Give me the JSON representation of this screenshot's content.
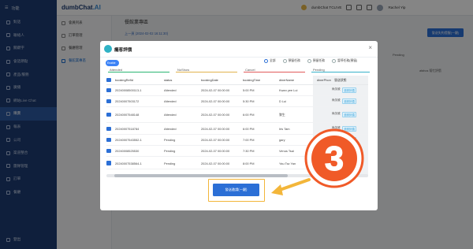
{
  "sidebar": {
    "top_label": "功能",
    "items": [
      {
        "label": "對話"
      },
      {
        "label": "聯絡人"
      },
      {
        "label": "關鍵字"
      },
      {
        "label": "會話節點"
      },
      {
        "label": "產品/服務"
      },
      {
        "label": "廣播"
      },
      {
        "label": "網站Live Chat"
      },
      {
        "label": "購賣"
      },
      {
        "label": "報表"
      },
      {
        "label": "公司"
      },
      {
        "label": "渠道整合"
      },
      {
        "label": "團隊管理"
      },
      {
        "label": "訂單"
      },
      {
        "label": "餐廳"
      }
    ],
    "active_index": 7,
    "bottom_label": "登出"
  },
  "topbar": {
    "brand_main": "dumbChat",
    "brand_suffix": ".AI",
    "account": "dumbChat TCLIVE",
    "user": "Rachel Yip"
  },
  "subnav": {
    "items": [
      {
        "label": "會員列表"
      },
      {
        "label": "訂單管理"
      },
      {
        "label": "餐廳管理"
      },
      {
        "label": "餐館業專區"
      }
    ],
    "active_index": 3
  },
  "main": {
    "title": "餐館業專區",
    "date_line": "上一頁  (2024-02-02 16:11:30)",
    "action_button": "發送失約提醒(一鍵)",
    "bg_status": "Pending",
    "bg_cells": "afahos    幫忙評價"
  },
  "modal": {
    "title": "癱客評價",
    "close": "×",
    "toggle_label": "Enable",
    "radios": [
      {
        "label": "全部",
        "checked": true
      },
      {
        "label": "預留任務",
        "checked": false
      },
      {
        "label": "預留任務",
        "checked": false
      },
      {
        "label": "暫停任務(預留)",
        "checked": false
      }
    ],
    "status_row": [
      {
        "label": "Attended",
        "color": "#2bb673"
      },
      {
        "label": "NoShow",
        "color": "#e2b34d"
      },
      {
        "label": "Cancel",
        "color": "#e25a5a"
      },
      {
        "label": "Pending",
        "color": "#38b2c9"
      }
    ],
    "columns": [
      "bookingRefId",
      "status",
      "bookingDate",
      "bookingTime",
      "dinerName",
      "dinerPhon",
      "發送狀態"
    ],
    "rows": [
      {
        "ref": "20240008500113-1",
        "status": "Attended",
        "date": "2024-02-07 00:00:00",
        "time": "5:00 PM",
        "name": "Kwan yee Lui",
        "a": "尚欠收",
        "b": "邀請評價"
      },
      {
        "ref": "20240007503172",
        "status": "Attended",
        "date": "2024-02-07 00:00:00",
        "time": "5:30 PM",
        "name": "D Lui",
        "a": "尚欠收",
        "b": "邀請評價"
      },
      {
        "ref": "20240007548148",
        "status": "Attended",
        "date": "2024-02-07 00:00:00",
        "time": "6:00 PM",
        "name": "黎生",
        "a": "尚欠收",
        "b": "邀請評價"
      },
      {
        "ref": "20240007518784",
        "status": "Attended",
        "date": "2024-02-07 00:00:00",
        "time": "6:00 PM",
        "name": "Iris Tam",
        "a": "尚欠收",
        "b": "邀請評價"
      },
      {
        "ref": "20240007543552-1",
        "status": "Pending",
        "date": "2024-02-07 00:00:00",
        "time": "7:00 PM",
        "name": "gary",
        "a": "尚欠收",
        "b": "邀請評價"
      },
      {
        "ref": "20240008525530",
        "status": "Pending",
        "date": "2024-02-07 00:00:00",
        "time": "7:30 PM",
        "name": "Venus Tsai",
        "a": "尚欠收",
        "b": "邀請評價"
      },
      {
        "ref": "20240007538564-1",
        "status": "Pending",
        "date": "2024-02-07 00:00:00",
        "time": "8:00 PM",
        "name": "Yau Tsz Yan",
        "a": "尚欠收",
        "b": "邀請評價"
      }
    ],
    "confirm_button": "發送邀請(一鍵)"
  },
  "annotation": {
    "step_number": "3",
    "badge_color": "#f05a28",
    "arrow_color": "#f3b63a"
  }
}
